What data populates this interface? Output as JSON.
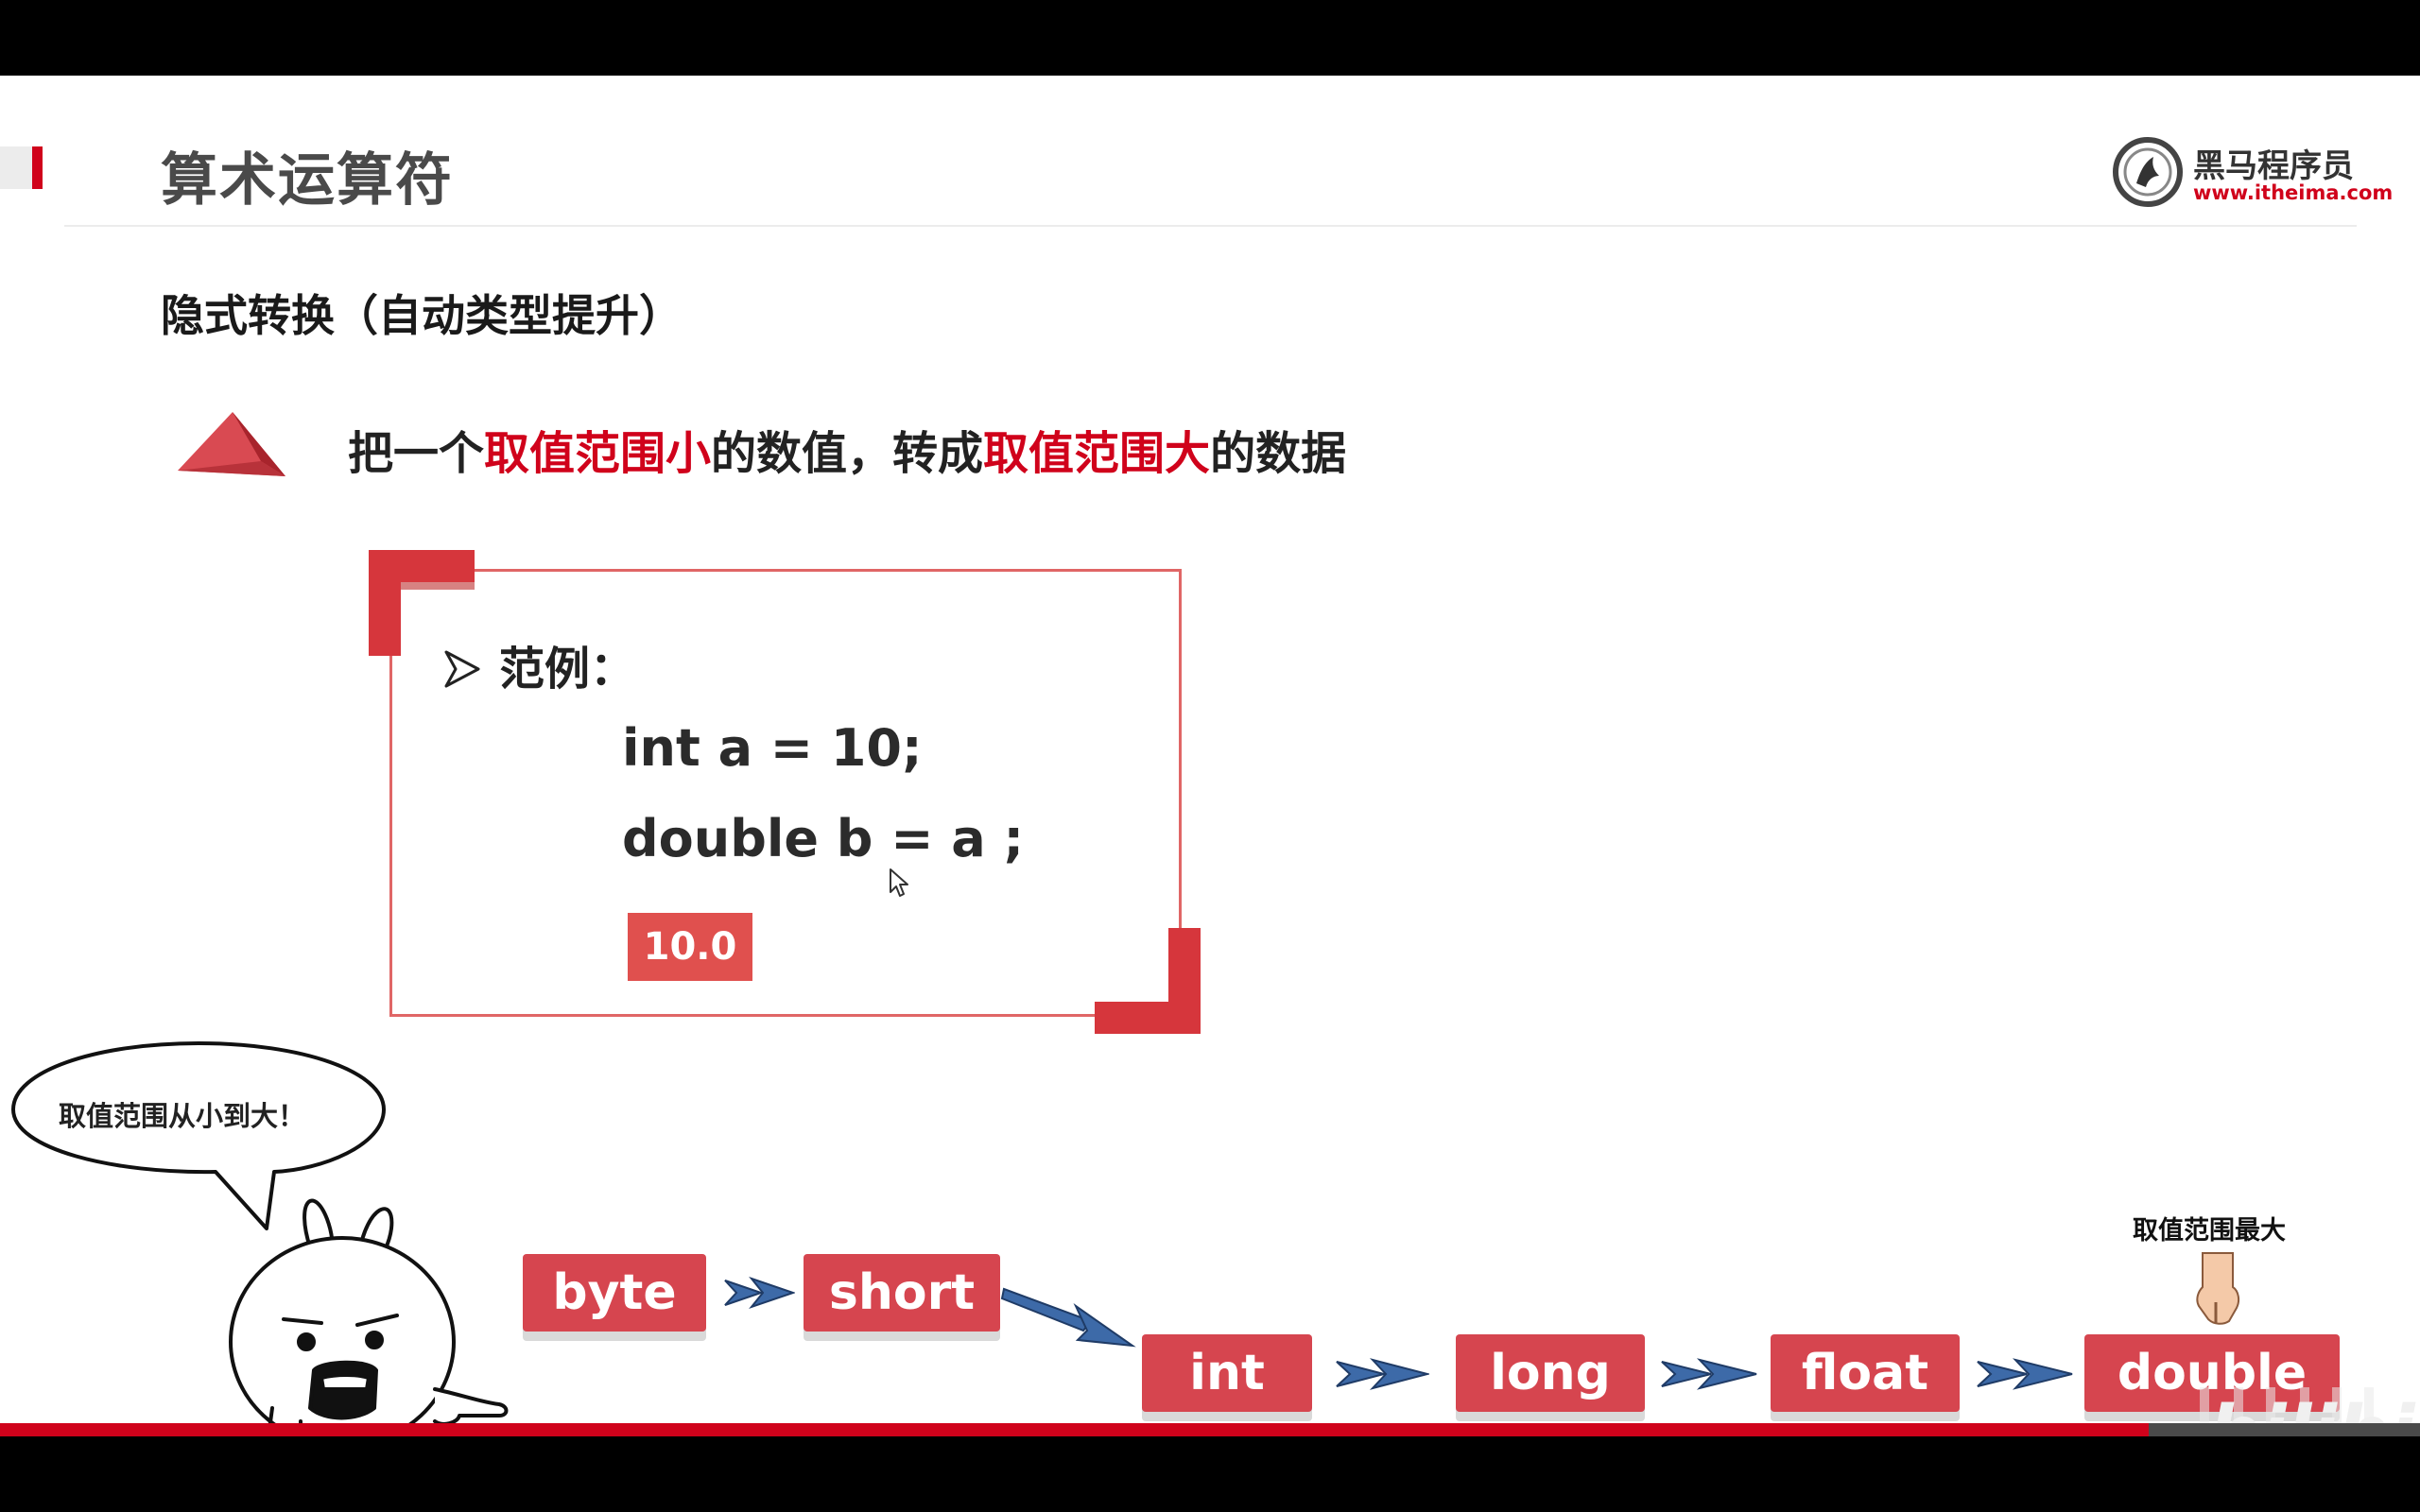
{
  "slide": {
    "title": "算术运算符",
    "logo": {
      "name": "黑马程序员",
      "url": "www.itheima.com"
    },
    "section_heading": "隐式转换（自动类型提升）",
    "lead": {
      "p1": "把一个",
      "hl1": "取值范围小",
      "p2": "的数值，转成",
      "hl2": "取值范围大",
      "p3": "的数据"
    },
    "example": {
      "label": "范例：",
      "code_line_1": "int a = 10;",
      "code_line_2": "double b = a ;",
      "result": "10.0"
    },
    "speech_bubble": "取值范围从小到大！",
    "type_chain": [
      "byte",
      "short",
      "int",
      "long",
      "float",
      "double"
    ],
    "max_label": "取值范围最大"
  },
  "watermark": "bilibili",
  "video": {
    "progress_fraction": 0.888
  },
  "colors": {
    "accent_red": "#d0021b",
    "box_red": "#d6454f",
    "arrow_blue": "#2c4a7a"
  }
}
